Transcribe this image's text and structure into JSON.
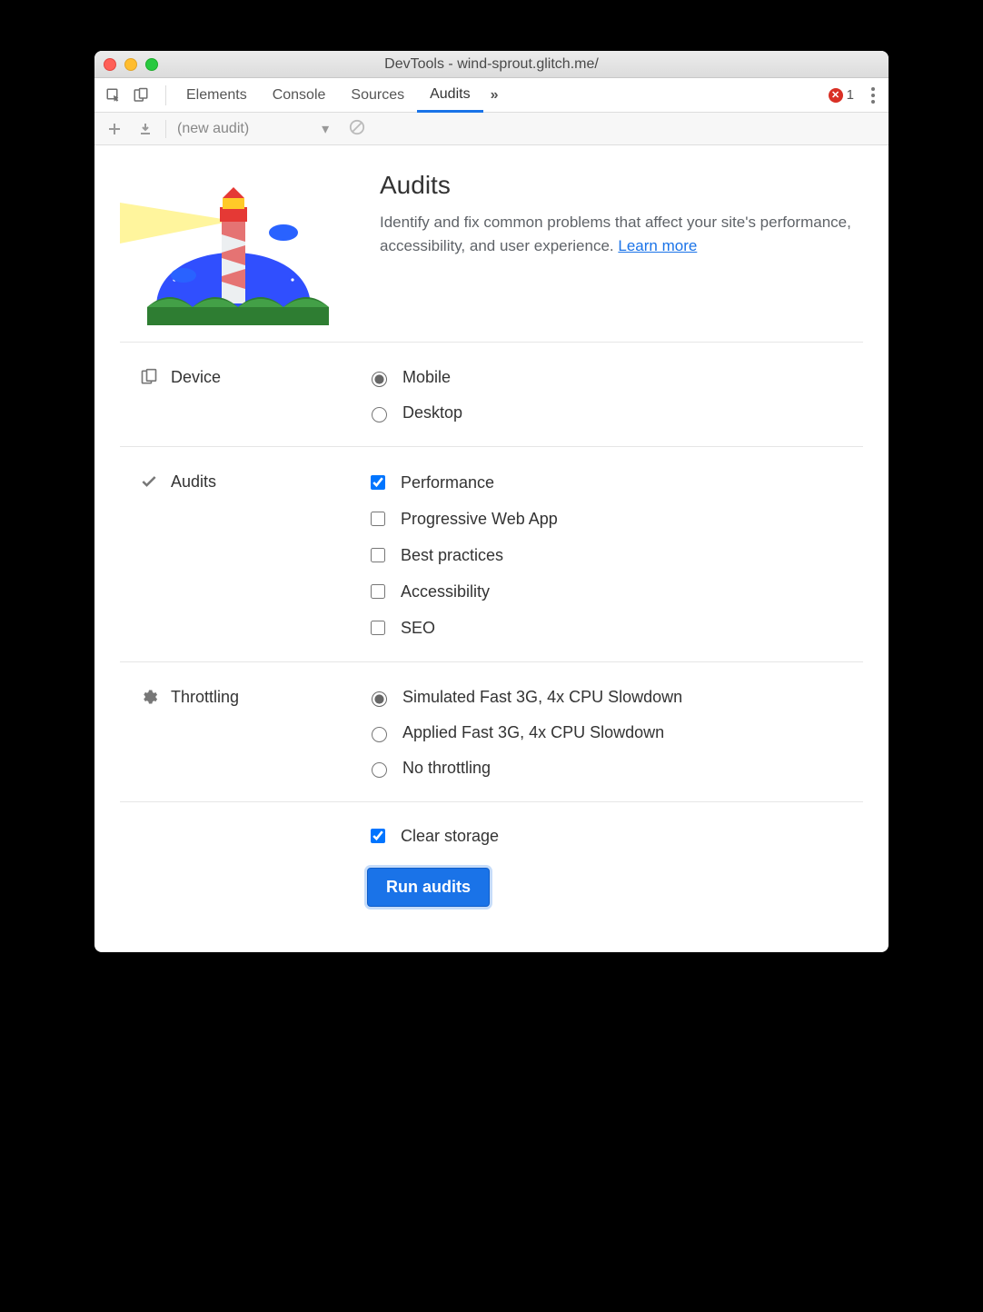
{
  "window": {
    "title": "DevTools - wind-sprout.glitch.me/"
  },
  "tabs": {
    "items": [
      "Elements",
      "Console",
      "Sources",
      "Audits"
    ],
    "active_index": 3,
    "overflow_glyph": "»",
    "errors": "1"
  },
  "subbar": {
    "dropdown_value": "(new audit)"
  },
  "hero": {
    "title": "Audits",
    "desc": "Identify and fix common problems that affect your site's performance, accessibility, and user experience. ",
    "learn_more": "Learn more"
  },
  "device": {
    "label": "Device",
    "options": [
      "Mobile",
      "Desktop"
    ],
    "selected": 0
  },
  "audits": {
    "label": "Audits",
    "options": [
      "Performance",
      "Progressive Web App",
      "Best practices",
      "Accessibility",
      "SEO"
    ],
    "checked": [
      true,
      false,
      false,
      false,
      false
    ]
  },
  "throttling": {
    "label": "Throttling",
    "options": [
      "Simulated Fast 3G, 4x CPU Slowdown",
      "Applied Fast 3G, 4x CPU Slowdown",
      "No throttling"
    ],
    "selected": 0
  },
  "clear_storage": {
    "label": "Clear storage",
    "checked": true
  },
  "run_button": "Run audits"
}
